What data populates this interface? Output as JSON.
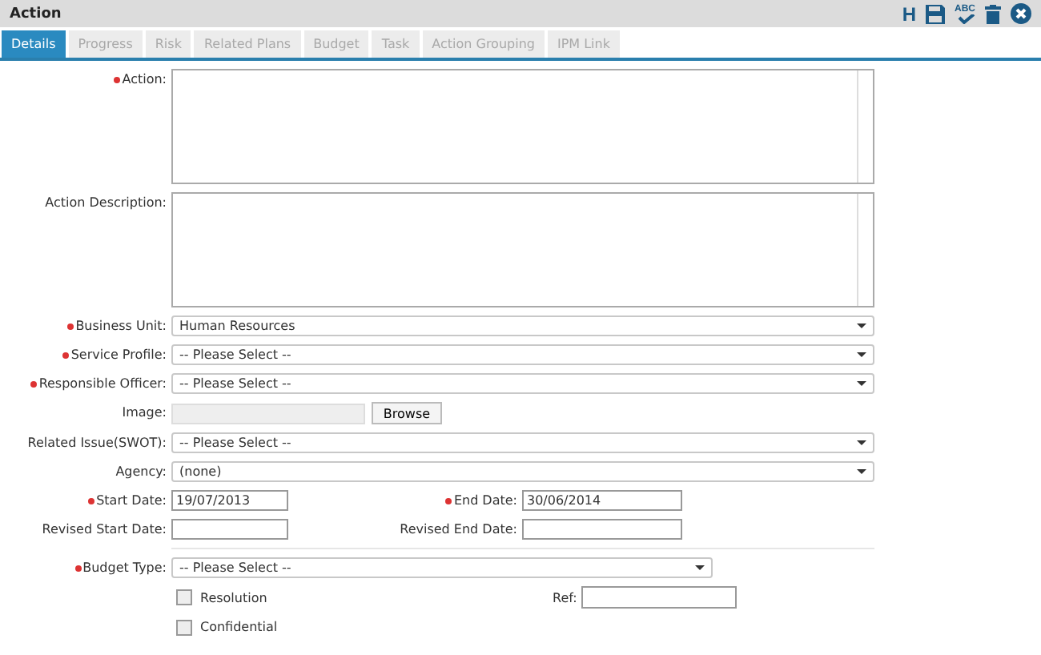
{
  "window": {
    "title": "Action",
    "toolbar": {
      "h_label": "H",
      "spell_label": "ABC"
    }
  },
  "tabs": [
    {
      "label": "Details",
      "selected": true
    },
    {
      "label": "Progress",
      "selected": false
    },
    {
      "label": "Risk",
      "selected": false
    },
    {
      "label": "Related Plans",
      "selected": false
    },
    {
      "label": "Budget",
      "selected": false
    },
    {
      "label": "Task",
      "selected": false
    },
    {
      "label": "Action Grouping",
      "selected": false
    },
    {
      "label": "IPM Link",
      "selected": false
    }
  ],
  "form": [
    {
      "kind": "textarea",
      "label": "Action:",
      "required": true
    },
    {
      "kind": "textarea",
      "label": "Action Description:",
      "required": false
    },
    {
      "kind": "select",
      "label": "Business Unit:",
      "required": true,
      "value": "Human Resources"
    },
    {
      "kind": "select",
      "label": "Service Profile:",
      "required": true,
      "value": "-- Please Select --"
    },
    {
      "kind": "select",
      "label": "Responsible Officer:",
      "required": true,
      "value": "-- Please Select --"
    },
    {
      "kind": "file",
      "label": "Image:",
      "required": false,
      "button": "Browse"
    },
    {
      "kind": "select",
      "label": "Related Issue(SWOT):",
      "required": false,
      "value": "-- Please Select --"
    },
    {
      "kind": "select",
      "label": "Agency:",
      "required": false,
      "value": "(none)"
    },
    {
      "kind": "dates",
      "fields": [
        {
          "label": "Start Date:",
          "required": true,
          "value": "19/07/2013"
        },
        {
          "label": "End Date:",
          "required": true,
          "value": "30/06/2014"
        }
      ]
    },
    {
      "kind": "dates",
      "fields": [
        {
          "label": "Revised Start Date:",
          "required": false
        },
        {
          "label": "Revised End Date:",
          "required": false
        }
      ]
    },
    {
      "kind": "divider"
    },
    {
      "kind": "short-select",
      "label": "Budget Type:",
      "required": true,
      "value": "-- Please Select --"
    },
    {
      "kind": "checkbox",
      "label": "Resolution",
      "checked": false,
      "side_label": "Ref:"
    },
    {
      "kind": "checkbox",
      "label": "Confidential",
      "checked": false
    }
  ]
}
